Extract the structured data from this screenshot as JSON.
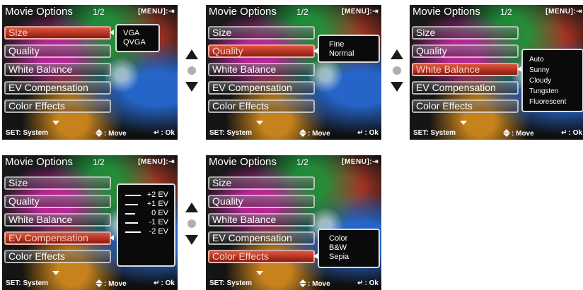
{
  "screens": [
    {
      "title": "Movie Options",
      "page": "1/2",
      "menu_label": "[MENU]:",
      "items": [
        "Size",
        "Quality",
        "White Balance",
        "EV Compensation",
        "Color Effects"
      ],
      "selected": 0,
      "popup": [
        "VGA",
        "QVGA"
      ],
      "footer": {
        "set": "SET: System",
        "move": ": Move",
        "ok": ": Ok"
      }
    },
    {
      "title": "Movie Options",
      "page": "1/2",
      "menu_label": "[MENU]:",
      "items": [
        "Size",
        "Quality",
        "White Balance",
        "EV Compensation",
        "Color Effects"
      ],
      "selected": 1,
      "popup": [
        "Fine",
        "Normal"
      ],
      "footer": {
        "set": "SET: System",
        "move": ": Move",
        "ok": ": Ok"
      }
    },
    {
      "title": "Movie Options",
      "page": "1/2",
      "menu_label": "[MENU]:",
      "items": [
        "Size",
        "Quality",
        "White Balance",
        "EV Compensation",
        "Color Effects"
      ],
      "selected": 2,
      "popup": [
        "Auto",
        "Sunny",
        "Cloudy",
        "Tungsten",
        "Fluorescent"
      ],
      "footer": {
        "set": "SET: System",
        "move": ": Move",
        "ok": ": Ok"
      }
    },
    {
      "title": "Movie Options",
      "page": "1/2",
      "menu_label": "[MENU]:",
      "items": [
        "Size",
        "Quality",
        "White Balance",
        "EV Compensation",
        "Color Effects"
      ],
      "selected": 3,
      "ev_scale": [
        "+2 EV",
        "+1 EV",
        "0 EV",
        "-1 EV",
        "-2 EV"
      ],
      "footer": {
        "set": "SET: System",
        "move": ": Move",
        "ok": ": Ok"
      }
    },
    {
      "title": "Movie Options",
      "page": "1/2",
      "menu_label": "[MENU]:",
      "items": [
        "Size",
        "Quality",
        "White Balance",
        "EV Compensation",
        "Color Effects"
      ],
      "selected": 4,
      "popup": [
        "Color",
        "B&W",
        "Sepia"
      ],
      "footer": {
        "set": "SET: System",
        "move": ": Move",
        "ok": ": Ok"
      }
    }
  ],
  "nav_icons": [
    "up-arrow-icon",
    "dot-icon",
    "down-arrow-icon"
  ]
}
